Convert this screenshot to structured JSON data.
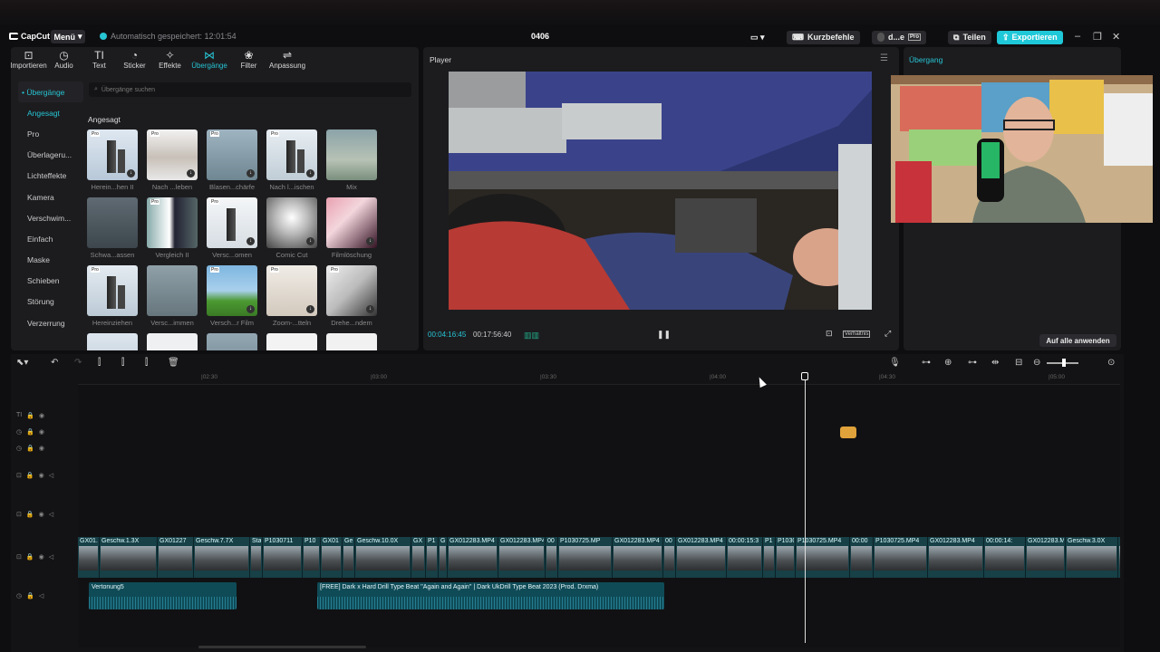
{
  "app": {
    "logo": "CapCut",
    "menu_label": "Menü",
    "autosave_text": "Automatisch gespeichert: 12:01:54",
    "project_title": "0406",
    "shortcuts_label": "Kurzbefehle",
    "user_label": "d...e",
    "share_label": "Teilen",
    "export_label": "Exportieren"
  },
  "toolbar": {
    "items": [
      {
        "label": "Importieren",
        "icon": "import-icon"
      },
      {
        "label": "Audio",
        "icon": "audio-icon"
      },
      {
        "label": "Text",
        "icon": "text-icon"
      },
      {
        "label": "Sticker",
        "icon": "sticker-icon"
      },
      {
        "label": "Effekte",
        "icon": "effects-icon"
      },
      {
        "label": "Übergänge",
        "icon": "transitions-icon",
        "active": true
      },
      {
        "label": "Filter",
        "icon": "filter-icon"
      },
      {
        "label": "Anpassung",
        "icon": "adjust-icon"
      }
    ]
  },
  "sidebar": {
    "header": "• Übergänge",
    "items": [
      "Angesagt",
      "Pro",
      "Überlageru...",
      "Lichteffekte",
      "Kamera",
      "Verschwim...",
      "Einfach",
      "Maske",
      "Schieben",
      "Störung",
      "Verzerrung"
    ]
  },
  "search": {
    "placeholder": "Übergänge suchen"
  },
  "section_title": "Angesagt",
  "transitions": [
    "Herein...hen II",
    "Nach ...leben",
    "Blasen...chärfe",
    "Nach l...ischen",
    "Mix",
    "Schwa...assen",
    "Vergleich II",
    "Versc...omen",
    "Comic Cut",
    "Filmlöschung",
    "Hereinziehen",
    "Versc...immen",
    "Versch...r Film",
    "Zoom-...tteln",
    "Drehe...ndem"
  ],
  "tile_tag": "Pro",
  "player": {
    "title": "Player",
    "current_time": "00:04:16:45",
    "total_time": "00:17:56:40",
    "ratio_label": "Verhältnis"
  },
  "inspector": {
    "title": "Übergang",
    "apply_all": "Auf alle anwenden"
  },
  "timeline": {
    "ruler_labels": [
      "|02:30",
      "|03:00",
      "|03:30",
      "|04:00",
      "|04:30",
      "|05:00"
    ],
    "clips": [
      "GX01...",
      "Geschw.1.3X",
      "GX01227",
      "Geschw.7.7X",
      "Sta",
      "P1030711",
      "P10",
      "GX01",
      "Ge",
      "Geschw.10.0X",
      "GX",
      "P1",
      "G",
      "GX012283.MP4",
      "GX012283.MP4",
      "00",
      "P1030725.MP",
      "GX012283.MP4",
      "00",
      "GX012283.MP4",
      "00:00:15:3",
      "P1",
      "P1030",
      "P1030725.MP4",
      "00:00",
      "P1030725.MP4",
      "GX012283.MP4",
      "00:00:14:",
      "GX012283.M",
      "Geschw.3.0X",
      "F",
      "G"
    ],
    "audio1": "Vertonung5",
    "audio2": "[FREE] Dark x Hard Drill Type Beat ''Again and Again'' | Dark UkDrill Type Beat 2023 (Prod. Drxma)"
  },
  "colors": {
    "accent": "#27c4d3",
    "marker": "#e0a23a"
  }
}
